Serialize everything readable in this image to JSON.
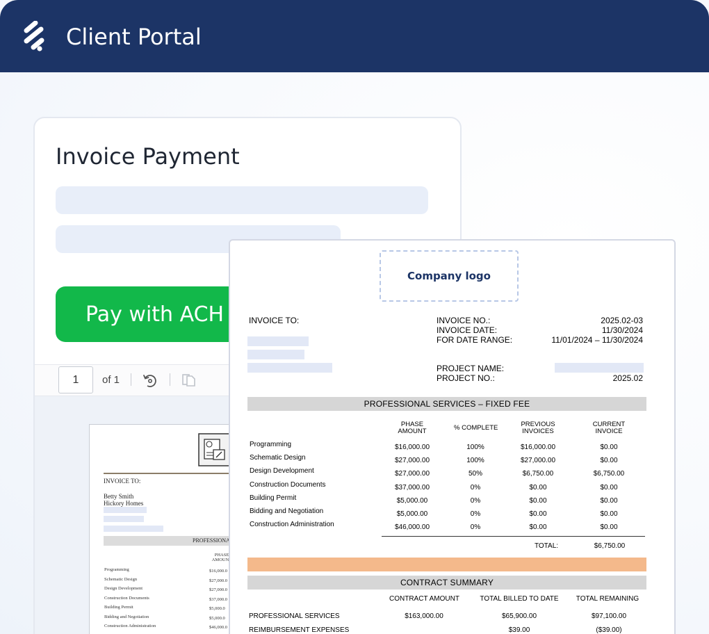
{
  "app": {
    "title": "Client Portal",
    "logo_icon": "stripes-logo-icon"
  },
  "payment": {
    "title": "Invoice Payment",
    "ach_button": "Pay with ACH"
  },
  "viewer": {
    "page_value": "1",
    "page_of": "of 1",
    "rotate_icon": "rotate-icon",
    "pages_icon": "pages-icon"
  },
  "thumbnail": {
    "invoice_to": "INVOICE TO:",
    "client_name": "Betty Smith",
    "client_company": "Hickory Homes",
    "band_title": "PROFESSIONA",
    "phase_header": "PHASE AMOUNT",
    "rows": [
      {
        "label": "Programming",
        "amount": "$16,000.0"
      },
      {
        "label": "Schematic Design",
        "amount": "$27,000.0"
      },
      {
        "label": "Design Development",
        "amount": "$27,000.0"
      },
      {
        "label": "Construction Documents",
        "amount": "$37,000.0"
      },
      {
        "label": "Building Permit",
        "amount": "$5,000.0"
      },
      {
        "label": "Bidding and Negotiation",
        "amount": "$5,000.0"
      },
      {
        "label": "Construction Administration",
        "amount": "$46,000.0"
      }
    ]
  },
  "invoice": {
    "company_logo": "Company logo",
    "invoice_to": "INVOICE TO:",
    "meta_labels": {
      "invoice_no": "INVOICE NO.:",
      "invoice_date": "INVOICE DATE:",
      "date_range": "FOR DATE RANGE:",
      "project_name": "PROJECT NAME:",
      "project_no": "PROJECT NO.:"
    },
    "meta_values": {
      "invoice_no": "2025.02-03",
      "invoice_date": "11/30/2024",
      "date_range": "11/01/2024  – 11/30/2024",
      "project_no": "2025.02"
    },
    "section_title": "PROFESSIONAL SERVICES – FIXED FEE",
    "columns": {
      "phase_1": "PHASE",
      "phase_2": "AMOUNT",
      "complete": "% COMPLETE",
      "previous_1": "PREVIOUS",
      "previous_2": "INVOICES",
      "current_1": "CURRENT",
      "current_2": "INVOICE"
    },
    "rows": [
      {
        "label": "Programming",
        "phase": "$16,000.00",
        "complete": "100%",
        "previous": "$16,000.00",
        "current": "$0.00"
      },
      {
        "label": "Schematic Design",
        "phase": "$27,000.00",
        "complete": "100%",
        "previous": "$27,000.00",
        "current": "$0.00"
      },
      {
        "label": "Design Development",
        "phase": "$27,000.00",
        "complete": "50%",
        "previous": "$6,750.00",
        "current": "$6,750.00"
      },
      {
        "label": "Construction Documents",
        "phase": "$37,000.00",
        "complete": "0%",
        "previous": "$0.00",
        "current": "$0.00"
      },
      {
        "label": "Building Permit",
        "phase": "$5,000.00",
        "complete": "0%",
        "previous": "$0.00",
        "current": "$0.00"
      },
      {
        "label": "Bidding and Negotiation",
        "phase": "$5,000.00",
        "complete": "0%",
        "previous": "$0.00",
        "current": "$0.00"
      },
      {
        "label": "Construction Administration",
        "phase": "$46,000.00",
        "complete": "0%",
        "previous": "$0.00",
        "current": "$0.00"
      }
    ],
    "total_label": "TOTAL:",
    "total_value": "$6,750.00",
    "summary_title": "CONTRACT SUMMARY",
    "summary_columns": {
      "amount": "CONTRACT AMOUNT",
      "billed": "TOTAL BILLED TO DATE",
      "remaining": "TOTAL REMAINING"
    },
    "summary_rows": [
      {
        "label": "PROFESSIONAL SERVICES",
        "amount": "$163,000.00",
        "billed": "$65,900.00",
        "remaining": "$97,100.00"
      },
      {
        "label": "REIMBURSEMENT EXPENSES",
        "amount": "",
        "billed": "$39.00",
        "remaining": "($39.00)"
      }
    ]
  },
  "colors": {
    "header": "#1c3466",
    "ach_button": "#12b84a",
    "skeleton": "#e8eef9",
    "orange_band": "#f4b98b"
  }
}
